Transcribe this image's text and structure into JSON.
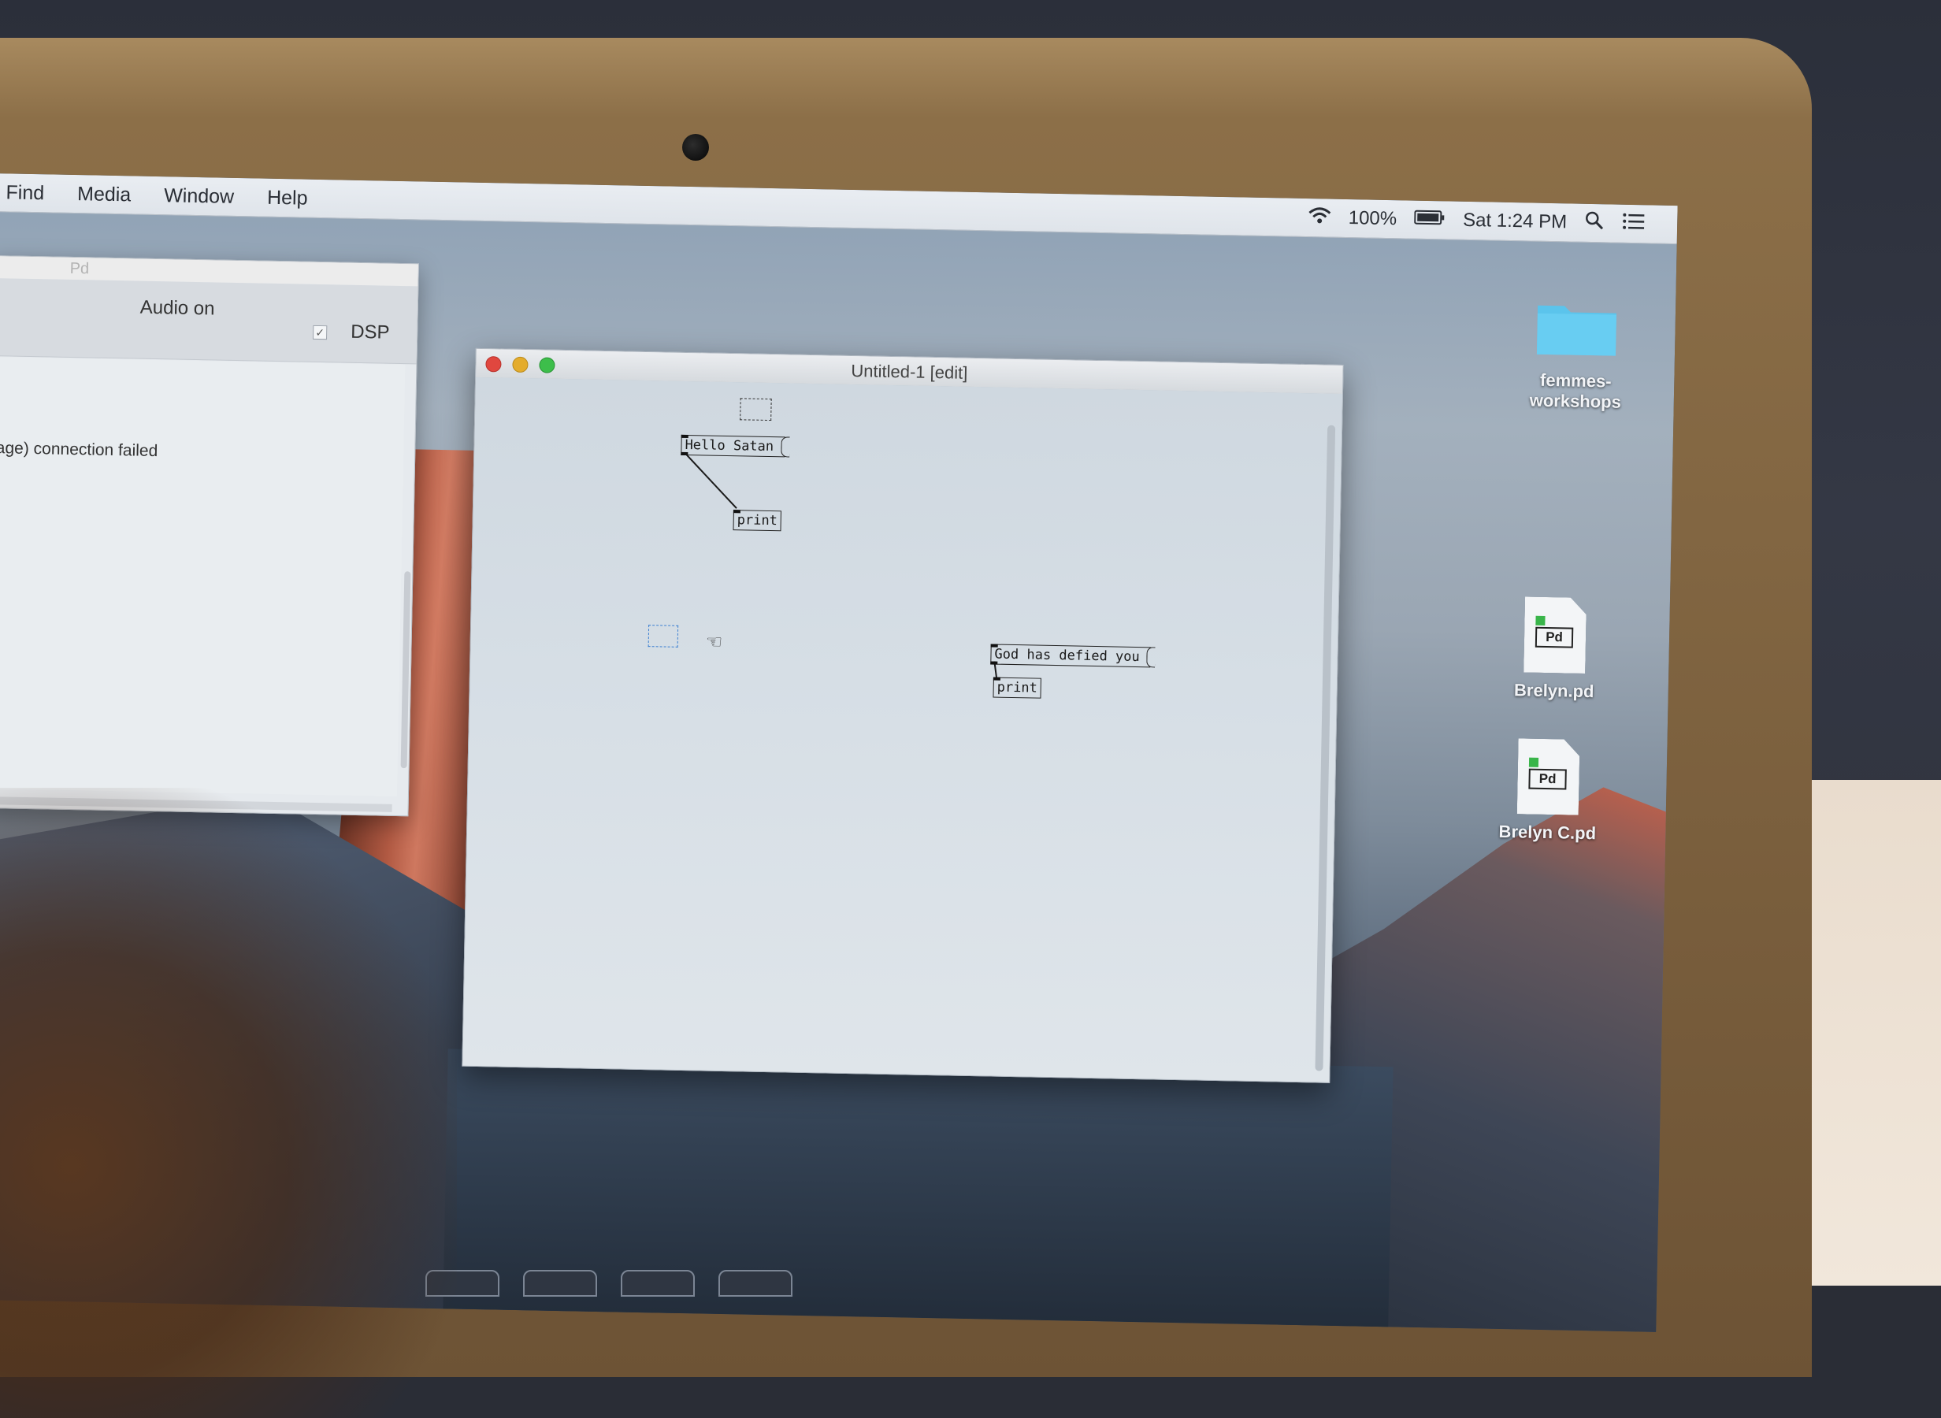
{
  "menubar": {
    "items": [
      "Find",
      "Media",
      "Window",
      "Help"
    ],
    "status": {
      "battery": "100%",
      "clock": "Sat 1:24 PM"
    },
    "icons": [
      "wifi-icon",
      "battery-icon",
      "spotlight-search-icon",
      "notification-center-icon"
    ]
  },
  "pd_console": {
    "title": "Pd",
    "audio_status": "Audio on",
    "dsp_label": "DSP",
    "dsp_checked": true,
    "log": [
      "sage) connection failed"
    ]
  },
  "patch_window": {
    "title": "Untitled-1 [edit]",
    "objects": [
      {
        "kind": "message",
        "text": "Hello Satan"
      },
      {
        "kind": "object",
        "text": "print"
      },
      {
        "kind": "message",
        "text": "God has defied you"
      },
      {
        "kind": "object",
        "text": "print"
      }
    ]
  },
  "desktop_icons": [
    {
      "label": "femmes-workshops",
      "type": "folder"
    },
    {
      "label": "Brelyn.pd",
      "type": "pd-file",
      "badge": "Pd"
    },
    {
      "label": "Brelyn C.pd",
      "type": "pd-file",
      "badge": "Pd"
    }
  ],
  "colors": {
    "close": "#e0473f",
    "minimize": "#e4ac2c",
    "zoom": "#3dbe4b",
    "folder": "#5bc4ec",
    "pd_green": "#39b54a"
  }
}
